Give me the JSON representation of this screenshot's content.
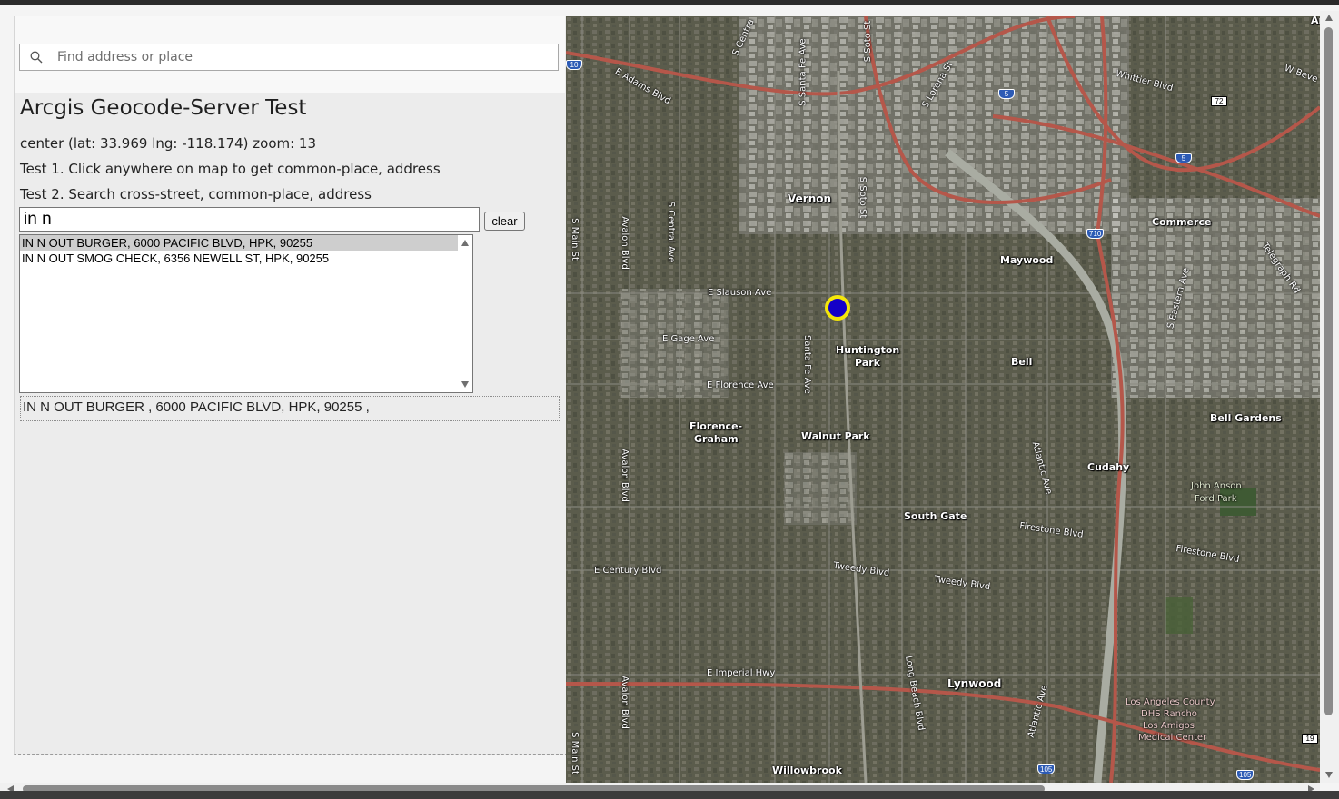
{
  "geosearch": {
    "placeholder": "Find address or place"
  },
  "panel": {
    "title": "Arcgis Geocode-Server Test",
    "center_line": "center (lat: 33.969 lng: -118.174) zoom: 13",
    "test1": "Test 1. Click anywhere on map to get common-place, address",
    "test2": "Test 2. Search cross-street, common-place, address"
  },
  "search": {
    "value": "in n",
    "clear_label": "clear",
    "results": [
      "IN N OUT BURGER, 6000 PACIFIC BLVD, HPK, 90255",
      "IN N OUT SMOG CHECK, 6356 NEWELL ST, HPK, 90255"
    ],
    "selected_index": 0,
    "selected_result": "IN N OUT BURGER , 6000 PACIFIC BLVD, HPK, 90255 ,"
  },
  "map": {
    "places": {
      "angeles": "Angeles",
      "vernon": "Vernon",
      "commerce": "Commerce",
      "maywood": "Maywood",
      "huntington_park_1": "Huntington",
      "huntington_park_2": "Park",
      "bell": "Bell",
      "bell_gardens": "Bell Gardens",
      "florence_graham_1": "Florence-",
      "florence_graham_2": "Graham",
      "walnut_park": "Walnut Park",
      "cudahy": "Cudahy",
      "south_gate": "South Gate",
      "lynwood": "Lynwood",
      "willowbrook": "Willowbrook",
      "john_anson_1": "John Anson",
      "john_anson_2": "Ford Park",
      "la_county_1": "Los Angeles County",
      "la_county_2": "DHS Rancho",
      "la_county_3": "Los Amigos",
      "la_county_4": "Medical Center"
    },
    "streets": {
      "e_adams": "E Adams Blvd",
      "whittier": "Whittier Blvd",
      "w_beve": "W Beve",
      "e_slauson": "E Slauson Ave",
      "e_gage": "E Gage Ave",
      "e_florence": "E Florence Ave",
      "e_century": "E Century Blvd",
      "tweedy_1": "Tweedy Blvd",
      "tweedy_2": "Tweedy Blvd",
      "firestone_1": "Firestone Blvd",
      "firestone_2": "Firestone Blvd",
      "e_imperial": "E Imperial Hwy",
      "s_main_1": "S Main St",
      "s_main_2": "S Main St",
      "avalon_1": "Avalon Blvd",
      "avalon_2": "Avalon Blvd",
      "avalon_3": "Avalon Blvd",
      "s_central": "S Central Ave",
      "s_santa_fe": "S Santa Fe Ave",
      "santa_fe": "Santa Fe Ave",
      "s_soto_1": "S Soto St",
      "s_soto_2": "S Soto St",
      "s_lorena": "S Lorena St",
      "atlantic_1": "Atlantic Ave",
      "atlantic_2": "Atlantic Ave",
      "long_beach": "Long Beach Blvd",
      "s_eastern": "S Eastern Ave",
      "telegraph": "Telegraph Rd",
      "s_centra": "S Centra"
    },
    "shields": {
      "i5_a": "5",
      "i5_b": "5",
      "i710": "710",
      "i105_a": "105",
      "i105_b": "105",
      "i10": "10",
      "sr72": "72",
      "sr19": "19"
    },
    "marker_lat": 33.969,
    "marker_lng": -118.174
  }
}
